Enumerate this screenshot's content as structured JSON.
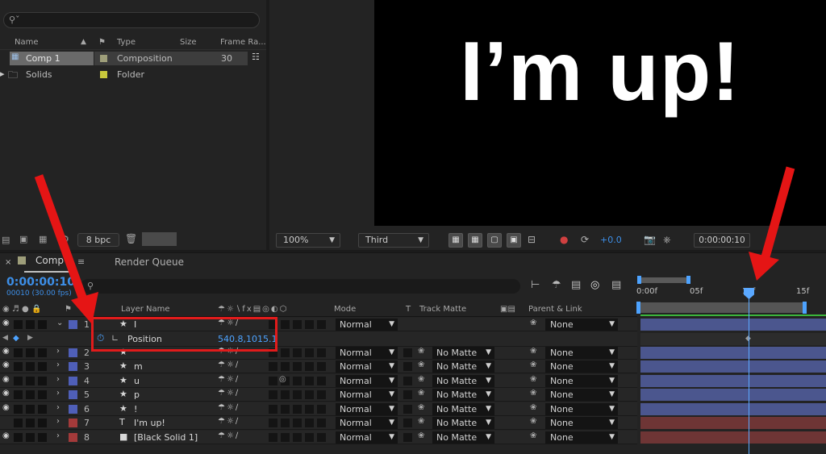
{
  "project": {
    "search_placeholder": "",
    "columns": {
      "name": "Name",
      "type": "Type",
      "size": "Size",
      "frame_rate": "Frame Ra..."
    },
    "items": [
      {
        "name": "Comp 1",
        "type": "Composition",
        "frame_rate": "30",
        "swatch": "#9e9e7a"
      },
      {
        "name": "Solids",
        "type": "Folder",
        "frame_rate": "",
        "swatch": "#c8c83c"
      }
    ],
    "bpc": "8 bpc"
  },
  "viewer": {
    "comp_text": "I’m up!",
    "zoom": "100%",
    "view": "Third",
    "exposure": "+0.0",
    "timecode": "0:00:00:10"
  },
  "timeline": {
    "comp_tab": "Comp 1",
    "render_tab": "Render Queue",
    "timecode": "0:00:00:10",
    "frames": "00010 (30.00 fps)",
    "columns": {
      "layer_name": "Layer Name",
      "mode": "Mode",
      "t": "T",
      "track_matte": "Track Matte",
      "parent": "Parent & Link"
    },
    "layers": [
      {
        "num": "1",
        "type": "★",
        "name": "I",
        "mode": "Normal",
        "matte": "",
        "parent": "None",
        "label": "#4f5fb8",
        "expanded": true
      },
      {
        "num": "2",
        "type": "★",
        "name": "’",
        "mode": "Normal",
        "matte": "No Matte",
        "parent": "None",
        "label": "#4f5fb8"
      },
      {
        "num": "3",
        "type": "★",
        "name": "m",
        "mode": "Normal",
        "matte": "No Matte",
        "parent": "None",
        "label": "#4f5fb8"
      },
      {
        "num": "4",
        "type": "★",
        "name": "u",
        "mode": "Normal",
        "matte": "No Matte",
        "parent": "None",
        "label": "#4f5fb8"
      },
      {
        "num": "5",
        "type": "★",
        "name": "p",
        "mode": "Normal",
        "matte": "No Matte",
        "parent": "None",
        "label": "#4f5fb8"
      },
      {
        "num": "6",
        "type": "★",
        "name": "!",
        "mode": "Normal",
        "matte": "No Matte",
        "parent": "None",
        "label": "#4f5fb8"
      },
      {
        "num": "7",
        "type": "T",
        "name": "I'm up!",
        "mode": "Normal",
        "matte": "No Matte",
        "parent": "None",
        "label": "#a33a3a"
      },
      {
        "num": "8",
        "type": "■",
        "name": "[Black Solid 1]",
        "mode": "Normal",
        "matte": "No Matte",
        "parent": "None",
        "label": "#a33a3a"
      }
    ],
    "position": {
      "label": "Position",
      "value": "540.8,1015.1"
    },
    "ruler": [
      "0:00f",
      "05f",
      "10f",
      "15f"
    ]
  },
  "colors": {
    "accent_blue": "#3d8fe8",
    "highlight_red": "#e11b1b",
    "track_blue": "#4b568e",
    "track_red": "#6e3535"
  }
}
